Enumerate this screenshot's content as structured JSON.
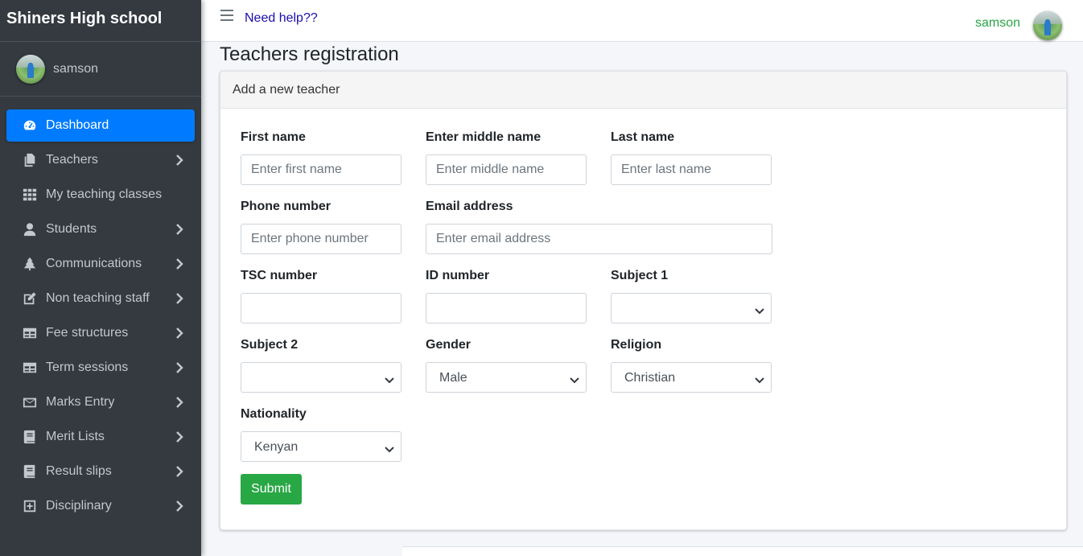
{
  "app": {
    "brand": "Shiners High school"
  },
  "user": {
    "name": "samson"
  },
  "sidebar": {
    "items": [
      {
        "label": "Dashboard",
        "icon": "dashboard-icon",
        "active": true
      },
      {
        "label": "Teachers",
        "icon": "copy-icon"
      },
      {
        "label": "My teaching classes",
        "icon": "grid-icon"
      },
      {
        "label": "Students",
        "icon": "user-icon"
      },
      {
        "label": "Communications",
        "icon": "tree-icon"
      },
      {
        "label": "Non teaching staff",
        "icon": "edit-icon"
      },
      {
        "label": "Fee structures",
        "icon": "table-icon"
      },
      {
        "label": "Term sessions",
        "icon": "table-icon"
      },
      {
        "label": "Marks Entry",
        "icon": "envelope-icon"
      },
      {
        "label": "Merit Lists",
        "icon": "book-icon"
      },
      {
        "label": "Result slips",
        "icon": "book-icon"
      },
      {
        "label": "Disciplinary",
        "icon": "plus-square-icon"
      }
    ]
  },
  "topbar": {
    "help": "Need help??",
    "user": "samson"
  },
  "page": {
    "title": "Teachers registration"
  },
  "card": {
    "header": "Add a new teacher"
  },
  "form": {
    "first_name": {
      "label": "First name",
      "placeholder": "Enter first name"
    },
    "middle_name": {
      "label": "Enter middle name",
      "placeholder": "Enter middle name"
    },
    "last_name": {
      "label": "Last name",
      "placeholder": "Enter last name"
    },
    "phone": {
      "label": "Phone number",
      "placeholder": "Enter phone number"
    },
    "email": {
      "label": "Email address",
      "placeholder": "Enter email address"
    },
    "tsc": {
      "label": "TSC number",
      "value": ""
    },
    "id_number": {
      "label": "ID number",
      "value": ""
    },
    "subject1": {
      "label": "Subject 1",
      "value": ""
    },
    "subject2": {
      "label": "Subject 2",
      "value": ""
    },
    "gender": {
      "label": "Gender",
      "value": "Male"
    },
    "religion": {
      "label": "Religion",
      "value": "Christian"
    },
    "nationality": {
      "label": "Nationality",
      "value": "Kenyan"
    },
    "submit": "Submit"
  },
  "colors": {
    "sidebar_bg": "#343a40",
    "active": "#007bff",
    "submit": "#28a745",
    "help_link": "#1a0dab",
    "top_user": "#28a745"
  }
}
